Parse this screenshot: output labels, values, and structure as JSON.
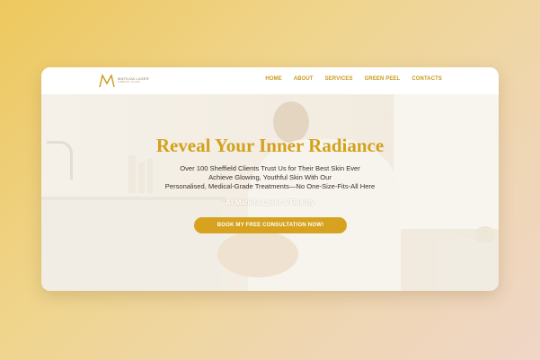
{
  "brand": {
    "name": "MATILDA LASER",
    "subtitle": "& BEAUTY CLINIC"
  },
  "nav": {
    "items": [
      "HOME",
      "ABOUT",
      "SERVICES",
      "GREEN PEEL",
      "CONTACTS"
    ]
  },
  "hero": {
    "title": "Reveal Your Inner Radiance",
    "subtitle_lines": [
      "Over 100 Sheffield Clients Trust Us for Their Best Skin Ever",
      "Achieve Glowing, Youthful Skin With Our",
      "Personalised, Medical-Grade Treatments—No One-Size-Fits-All Here"
    ],
    "tagline": "At Matilda Laser & Beauty",
    "cta_label": "BOOK MY FREE CONSULTATION NOW!"
  },
  "colors": {
    "accent": "#d6a21f",
    "nav_text": "#c99a1c",
    "title": "#d3a11c"
  }
}
